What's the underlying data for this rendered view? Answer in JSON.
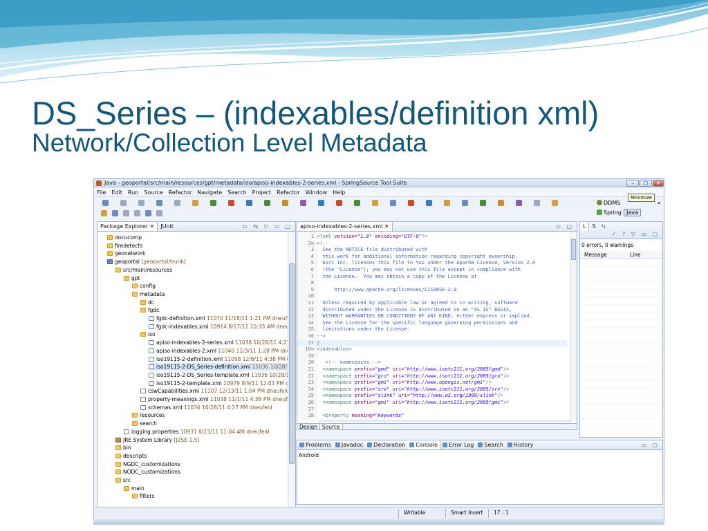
{
  "slide": {
    "title": "DS_Series – (indexables/definition xml)",
    "subtitle": "Network/Collection Level Metadata",
    "colors": {
      "title": "#13577a",
      "wave_light": "#bfe3f1",
      "wave_dark": "#4aa8cc"
    }
  },
  "window": {
    "title": "Java - geoportal/src/main/resources/gpt/metadata/iso/apiso-indexables-2-series.xml - SpringSource Tool Suite",
    "minimize_tooltip": "Minimize"
  },
  "menu": [
    "File",
    "Edit",
    "Run",
    "Source",
    "Refactor",
    "Navigate",
    "Search",
    "Project",
    "Refactor",
    "Window",
    "Help"
  ],
  "perspectives": {
    "ddms": "DDMS",
    "spring": "Spring",
    "java": "Java",
    "more": "»"
  },
  "package_explorer": {
    "tabs": [
      "Package Explorer",
      "JUnit"
    ],
    "items": [
      {
        "label": "docucomp",
        "meta": "",
        "indent": 1,
        "icon": "folder"
      },
      {
        "label": "firedetects",
        "meta": "",
        "indent": 1,
        "icon": "folder"
      },
      {
        "label": "geonetwork",
        "meta": "",
        "indent": 1,
        "icon": "folder"
      },
      {
        "label": "geoportal",
        "meta": "[geoportal/trunk]",
        "indent": 1,
        "icon": "proj"
      },
      {
        "label": "src/main/resources",
        "meta": "",
        "indent": 2,
        "icon": "folder"
      },
      {
        "label": "gpt",
        "meta": "",
        "indent": 3,
        "icon": "folder"
      },
      {
        "label": "config",
        "meta": "",
        "indent": 4,
        "icon": "folder"
      },
      {
        "label": "metadata",
        "meta": "",
        "indent": 4,
        "icon": "folder"
      },
      {
        "label": "dc",
        "meta": "",
        "indent": 5,
        "icon": "folder"
      },
      {
        "label": "fgdc",
        "meta": "",
        "indent": 5,
        "icon": "folder"
      },
      {
        "label": "fgdc-definition.xml",
        "meta": "11070  11/18/11 1:21 PM  dneufeld",
        "indent": 6,
        "icon": "xml"
      },
      {
        "label": "fgdc-indexables.xml",
        "meta": "10914  8/17/11 10:33 AM  dneufeld",
        "indent": 6,
        "icon": "xml"
      },
      {
        "label": "iso",
        "meta": "",
        "indent": 5,
        "icon": "folder"
      },
      {
        "label": "apiso-indexables-2-series.xml",
        "meta": "11036  10/28/11 4:27 PM",
        "indent": 6,
        "icon": "xml"
      },
      {
        "label": "apiso-indexables-2.xml",
        "meta": "11040  11/3/11 1:28 PM  dneufe",
        "indent": 6,
        "icon": "xml"
      },
      {
        "label": "iso19115-2-definition.xml",
        "meta": "11098  12/6/11 4:38 PM  dne",
        "indent": 6,
        "icon": "xml"
      },
      {
        "label": "iso19115-2-DS_Series-definition.xml",
        "meta": "11036  10/28/11 4:",
        "indent": 6,
        "icon": "xml",
        "selected": true
      },
      {
        "label": "iso19115-2-DS_Series-template.xml",
        "meta": "11036  10/28/11 4:2",
        "indent": 6,
        "icon": "xml"
      },
      {
        "label": "iso19115-2-template.xml",
        "meta": "10979  8/9/11 12:01 PM  dne",
        "indent": 6,
        "icon": "xml"
      },
      {
        "label": "cswCapabilities.xml",
        "meta": "11107  12/13/11 1:04 PM  dneufeld",
        "indent": 5,
        "icon": "xml"
      },
      {
        "label": "property-meanings.xml",
        "meta": "11038  11/1/11 4:38 PM  dneufeld",
        "indent": 5,
        "icon": "xml"
      },
      {
        "label": "schemas.xml",
        "meta": "11036  10/28/11 4:27 PM  dneufeld",
        "indent": 5,
        "icon": "xml"
      },
      {
        "label": "resources",
        "meta": "",
        "indent": 4,
        "icon": "folder"
      },
      {
        "label": "search",
        "meta": "",
        "indent": 4,
        "icon": "folder"
      },
      {
        "label": "logging.properties",
        "meta": "10931  8/23/11 11:04 AM  dneufeld",
        "indent": 3,
        "icon": "xml"
      },
      {
        "label": "JRE System Library",
        "meta": "[J2SE-1.5]",
        "indent": 2,
        "icon": "lib"
      },
      {
        "label": "bin",
        "meta": "",
        "indent": 2,
        "icon": "folder"
      },
      {
        "label": "dbscripts",
        "meta": "",
        "indent": 2,
        "icon": "folder"
      },
      {
        "label": "NGDC_customizations",
        "meta": "",
        "indent": 2,
        "icon": "folder"
      },
      {
        "label": "NODC_customizations",
        "meta": "",
        "indent": 2,
        "icon": "folder"
      },
      {
        "label": "src",
        "meta": "",
        "indent": 2,
        "icon": "folder"
      },
      {
        "label": "main",
        "meta": "",
        "indent": 3,
        "icon": "folder"
      },
      {
        "label": "filters",
        "meta": "",
        "indent": 4,
        "icon": "folder"
      }
    ]
  },
  "editor": {
    "tab": "apiso-indexables-2-series.xml",
    "lines": [
      {
        "n": "1",
        "parts": [
          [
            "tag",
            "<?xml "
          ],
          [
            "attr",
            "version="
          ],
          [
            "val",
            "\"1.0\""
          ],
          [
            "attr",
            " encoding="
          ],
          [
            "val",
            "\"UTF-8\""
          ],
          [
            "tag",
            "?>"
          ]
        ]
      },
      {
        "n": "2⊖",
        "parts": [
          [
            "txt",
            "<!--"
          ]
        ]
      },
      {
        "n": "3",
        "parts": [
          [
            "txt",
            "  See the NOTICE file distributed with"
          ]
        ]
      },
      {
        "n": "4",
        "parts": [
          [
            "txt",
            "  this work for additional information regarding copyright ownership."
          ]
        ]
      },
      {
        "n": "5",
        "parts": [
          [
            "txt",
            "  Esri Inc. licenses this file to You under the Apache License, Version 2.0"
          ]
        ]
      },
      {
        "n": "6",
        "parts": [
          [
            "txt",
            "  (the \"License\"); you may not use this file except in compliance with"
          ]
        ]
      },
      {
        "n": "7",
        "parts": [
          [
            "txt",
            "  the License.  You may obtain a copy of the License at"
          ]
        ]
      },
      {
        "n": "8",
        "parts": [
          [
            "txt",
            ""
          ]
        ]
      },
      {
        "n": "9",
        "parts": [
          [
            "txt",
            "      http://www.apache.org/licenses/LICENSE-2.0"
          ]
        ]
      },
      {
        "n": "10",
        "parts": [
          [
            "txt",
            ""
          ]
        ]
      },
      {
        "n": "11",
        "parts": [
          [
            "txt",
            "  Unless required by applicable law or agreed to in writing, software"
          ]
        ]
      },
      {
        "n": "12",
        "parts": [
          [
            "txt",
            "  distributed under the License is distributed on an \"AS IS\" BASIS,"
          ]
        ]
      },
      {
        "n": "13",
        "parts": [
          [
            "txt",
            "  WITHOUT WARRANTIES OR CONDITIONS OF ANY KIND, either express or implied."
          ]
        ]
      },
      {
        "n": "14",
        "parts": [
          [
            "txt",
            "  See the License for the specific language governing permissions and"
          ]
        ]
      },
      {
        "n": "15",
        "parts": [
          [
            "txt",
            "  limitations under the License."
          ]
        ]
      },
      {
        "n": "16",
        "parts": [
          [
            "txt",
            "-->"
          ]
        ]
      },
      {
        "n": "17",
        "parts": [
          [
            "txt",
            "|"
          ]
        ],
        "current": true
      },
      {
        "n": "18⊖",
        "parts": [
          [
            "tag",
            "<indexables>"
          ]
        ]
      },
      {
        "n": "19",
        "parts": [
          [
            "txt",
            ""
          ]
        ]
      },
      {
        "n": "20",
        "parts": [
          [
            "txt",
            "   <!-- namespaces -->"
          ]
        ]
      },
      {
        "n": "21",
        "parts": [
          [
            "tag",
            "  <namespace "
          ],
          [
            "attr",
            "prefix="
          ],
          [
            "val",
            "\"gmd\""
          ],
          [
            "attr",
            " uri="
          ],
          [
            "val",
            "\"http://www.isotc211.org/2005/gmd\""
          ],
          [
            "tag",
            "/>"
          ]
        ]
      },
      {
        "n": "22",
        "parts": [
          [
            "tag",
            "  <namespace "
          ],
          [
            "attr",
            "prefix="
          ],
          [
            "val",
            "\"gco\""
          ],
          [
            "attr",
            " uri="
          ],
          [
            "val",
            "\"http://www.isotc211.org/2005/gco\""
          ],
          [
            "tag",
            "/>"
          ]
        ]
      },
      {
        "n": "23",
        "parts": [
          [
            "tag",
            "  <namespace "
          ],
          [
            "attr",
            "prefix="
          ],
          [
            "val",
            "\"gmi\""
          ],
          [
            "attr",
            " uri="
          ],
          [
            "val",
            "\"http://www.opengis.net/gmi\""
          ],
          [
            "tag",
            "/>"
          ]
        ]
      },
      {
        "n": "24",
        "parts": [
          [
            "tag",
            "  <namespace "
          ],
          [
            "attr",
            "prefix="
          ],
          [
            "val",
            "\"srv\""
          ],
          [
            "attr",
            " uri="
          ],
          [
            "val",
            "\"http://www.isotc211.org/2005/srv\""
          ],
          [
            "tag",
            "/>"
          ]
        ]
      },
      {
        "n": "25",
        "parts": [
          [
            "tag",
            "  <namespace "
          ],
          [
            "attr",
            "prefix="
          ],
          [
            "val",
            "\"xlink\""
          ],
          [
            "attr",
            " uri="
          ],
          [
            "val",
            "\"http://www.w3.org/1999/xlink\""
          ],
          [
            "tag",
            "/>"
          ]
        ]
      },
      {
        "n": "26",
        "parts": [
          [
            "tag",
            "  <namespace "
          ],
          [
            "attr",
            "prefix="
          ],
          [
            "val",
            "\"gmi\""
          ],
          [
            "attr",
            " uri="
          ],
          [
            "val",
            "\"http://www.isotc211.org/2005/gmi\""
          ],
          [
            "tag",
            "/>"
          ]
        ]
      },
      {
        "n": "27",
        "parts": [
          [
            "txt",
            ""
          ]
        ]
      },
      {
        "n": "28",
        "parts": [
          [
            "tag",
            "  <property "
          ],
          [
            "attr",
            "meaning="
          ],
          [
            "val",
            "\"keywords\""
          ]
        ]
      }
    ],
    "bottom_tabs": [
      "Design",
      "Source"
    ]
  },
  "problems": {
    "tabs": [
      "L",
      "S",
      "¹₁"
    ],
    "summary": "0 errors, 0 warnings",
    "columns": [
      "Message",
      "Line"
    ]
  },
  "console": {
    "tabs": [
      "Problems",
      "Javadoc",
      "Declaration",
      "Console",
      "Error Log",
      "Search",
      "History"
    ],
    "content": "Android"
  },
  "statusbar": {
    "mode": "Writable",
    "insert": "Smart Insert",
    "position": "17 : 1"
  }
}
